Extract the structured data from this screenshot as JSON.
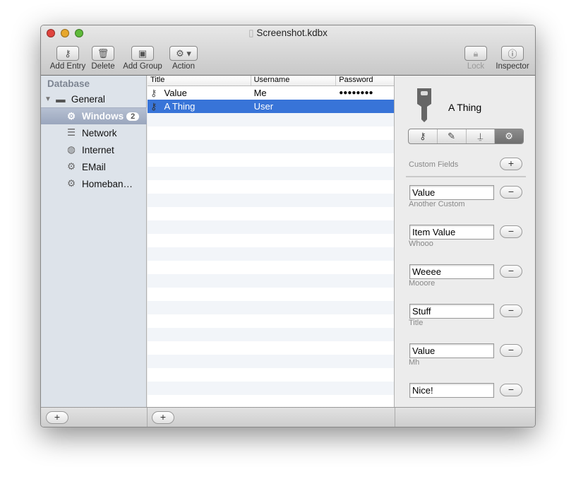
{
  "window": {
    "title": "Screenshot.kdbx"
  },
  "toolbar": {
    "add_entry": "Add Entry",
    "delete": "Delete",
    "add_group": "Add Group",
    "action": "Action",
    "lock": "Lock",
    "inspector": "Inspector"
  },
  "sidebar": {
    "header": "Database",
    "root": "General",
    "items": [
      {
        "label": "Windows",
        "icon": "gear-icon",
        "badge": "2"
      },
      {
        "label": "Network",
        "icon": "server-icon"
      },
      {
        "label": "Internet",
        "icon": "globe-icon"
      },
      {
        "label": "EMail",
        "icon": "gear-icon"
      },
      {
        "label": "Homeban…",
        "icon": "gear-icon"
      }
    ]
  },
  "list": {
    "columns": [
      "Title",
      "Username",
      "Password"
    ],
    "rows": [
      {
        "title": "Value",
        "username": "Me",
        "password": "●●●●●●●●"
      },
      {
        "title": "A Thing",
        "username": "User",
        "password": ""
      }
    ]
  },
  "inspector": {
    "entry_title": "A Thing",
    "section": "Custom Fields",
    "add": "+",
    "remove": "−",
    "fields": [
      {
        "label": "",
        "value": "Value"
      },
      {
        "label": "Another Custom",
        "value": "Item Value"
      },
      {
        "label": "Whooo",
        "value": "Weeee"
      },
      {
        "label": "Mooore",
        "value": "Stuff"
      },
      {
        "label": "Title",
        "value": "Value"
      },
      {
        "label": "Mh",
        "value": "Nice!"
      }
    ]
  },
  "bottom": {
    "add": "+"
  },
  "colors": {
    "selection": "#3874d8",
    "sidebar": "#dde3ea"
  }
}
